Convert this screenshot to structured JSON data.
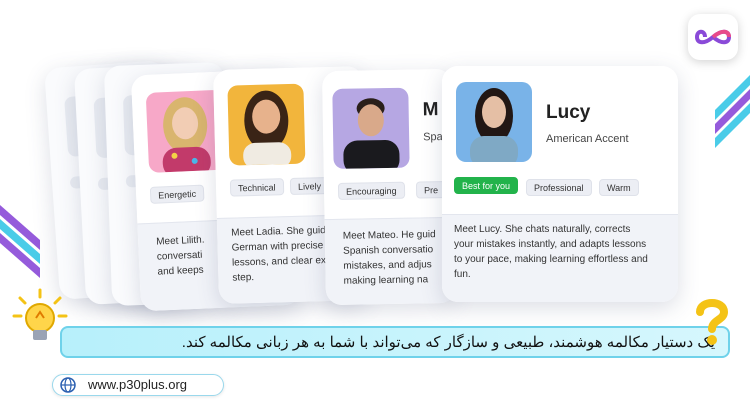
{
  "colors": {
    "accent_purple": "#8a4ad8",
    "accent_cyan": "#37c7e6",
    "best_green": "#22b34b",
    "banner_bg": "#c6f3fb"
  },
  "logo": {
    "icon": "infinity-icon"
  },
  "cards": {
    "lilith": {
      "description": "Meet Lilith.\nconversati\nand keeps",
      "tags": [
        "Energetic"
      ]
    },
    "ladia": {
      "description": "Meet Ladia. She guid\nGerman with precise\nlessons, and clear exp\nstep.",
      "tags": [
        "Technical",
        "Lively"
      ]
    },
    "mateo": {
      "name": "M",
      "accent": "Spa",
      "description": "Meet Mateo. He guid\nSpanish conversatio\nmistakes, and adjus\nmaking learning na",
      "tags": [
        "Encouraging",
        "Pre"
      ]
    },
    "lucy": {
      "name": "Lucy",
      "accent": "American Accent",
      "description": "Meet Lucy. She chats naturally, corrects\nyour mistakes instantly, and adapts lessons\nto your pace, making learning effortless and\nfun.",
      "tags": [
        "Best for you",
        "Professional",
        "Warm"
      ]
    }
  },
  "banner": {
    "text": "یک دستیار مکالمه هوشمند، طبیعی و سازگار که می‌تواند با شما به هر زبانی مکالمه کند.",
    "lightbulb_icon": "lightbulb-icon",
    "question_icon": "question-mark-icon"
  },
  "website": {
    "url": "www.p30plus.org",
    "icon": "globe-icon"
  }
}
